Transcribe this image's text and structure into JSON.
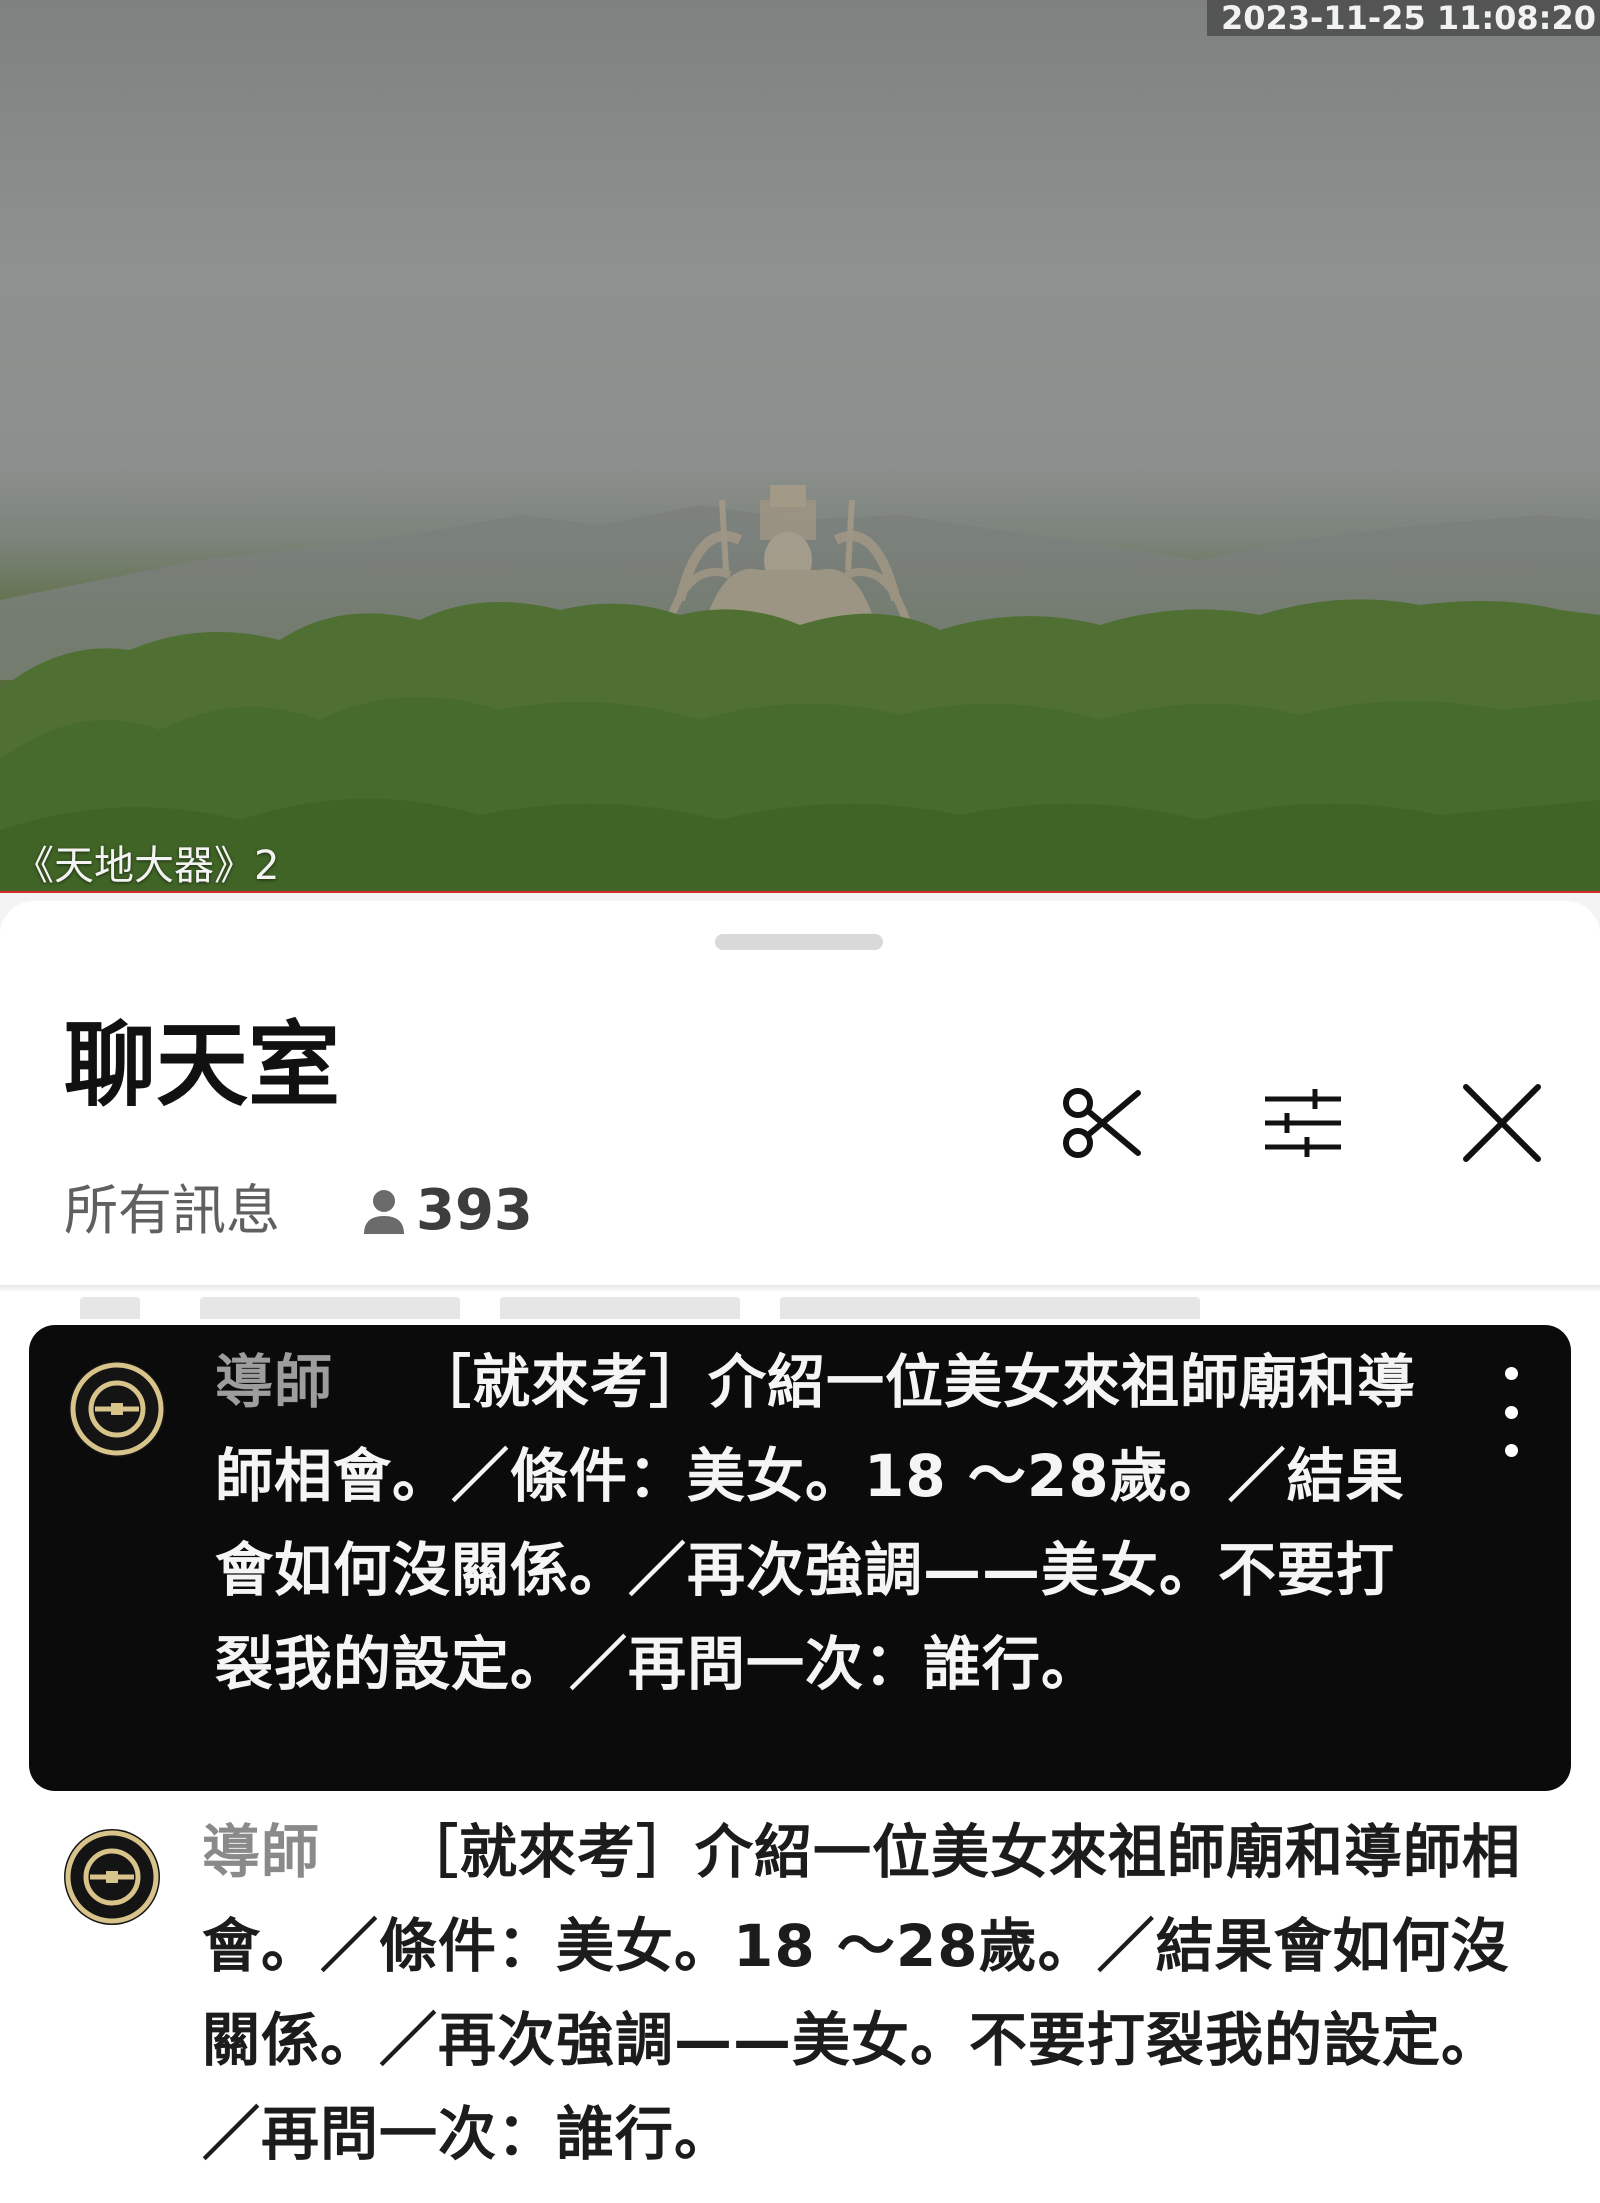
{
  "video": {
    "timestamp": "2023-11-25 11:08:20",
    "caption": "《天地大器》2"
  },
  "chat": {
    "title": "聊天室",
    "filter_label": "所有訊息",
    "viewer_count": "393",
    "header_icons": [
      "scissors-icon",
      "sliders-icon",
      "close-icon"
    ]
  },
  "messages": [
    {
      "author": "導師",
      "text": "［就來考］介紹一位美女來祖師廟和導師相會。／條件：美女。18 ～28歲。／結果會如何沒關係。／再次強調——美女。不要打裂我的設定。／再問一次：誰行。",
      "highlighted": true
    },
    {
      "author": "導師",
      "text": "［就來考］介紹一位美女來祖師廟和導師相會。／條件：美女。18 ～28歲。／結果會如何沒關係。／再次強調——美女。不要打裂我的設定。／再問一次：誰行。",
      "highlighted": false
    }
  ],
  "colors": {
    "progress_red": "#d32a2a",
    "avatar_gold": "#d8c48a",
    "pinned_background": "#0b0b0b"
  }
}
